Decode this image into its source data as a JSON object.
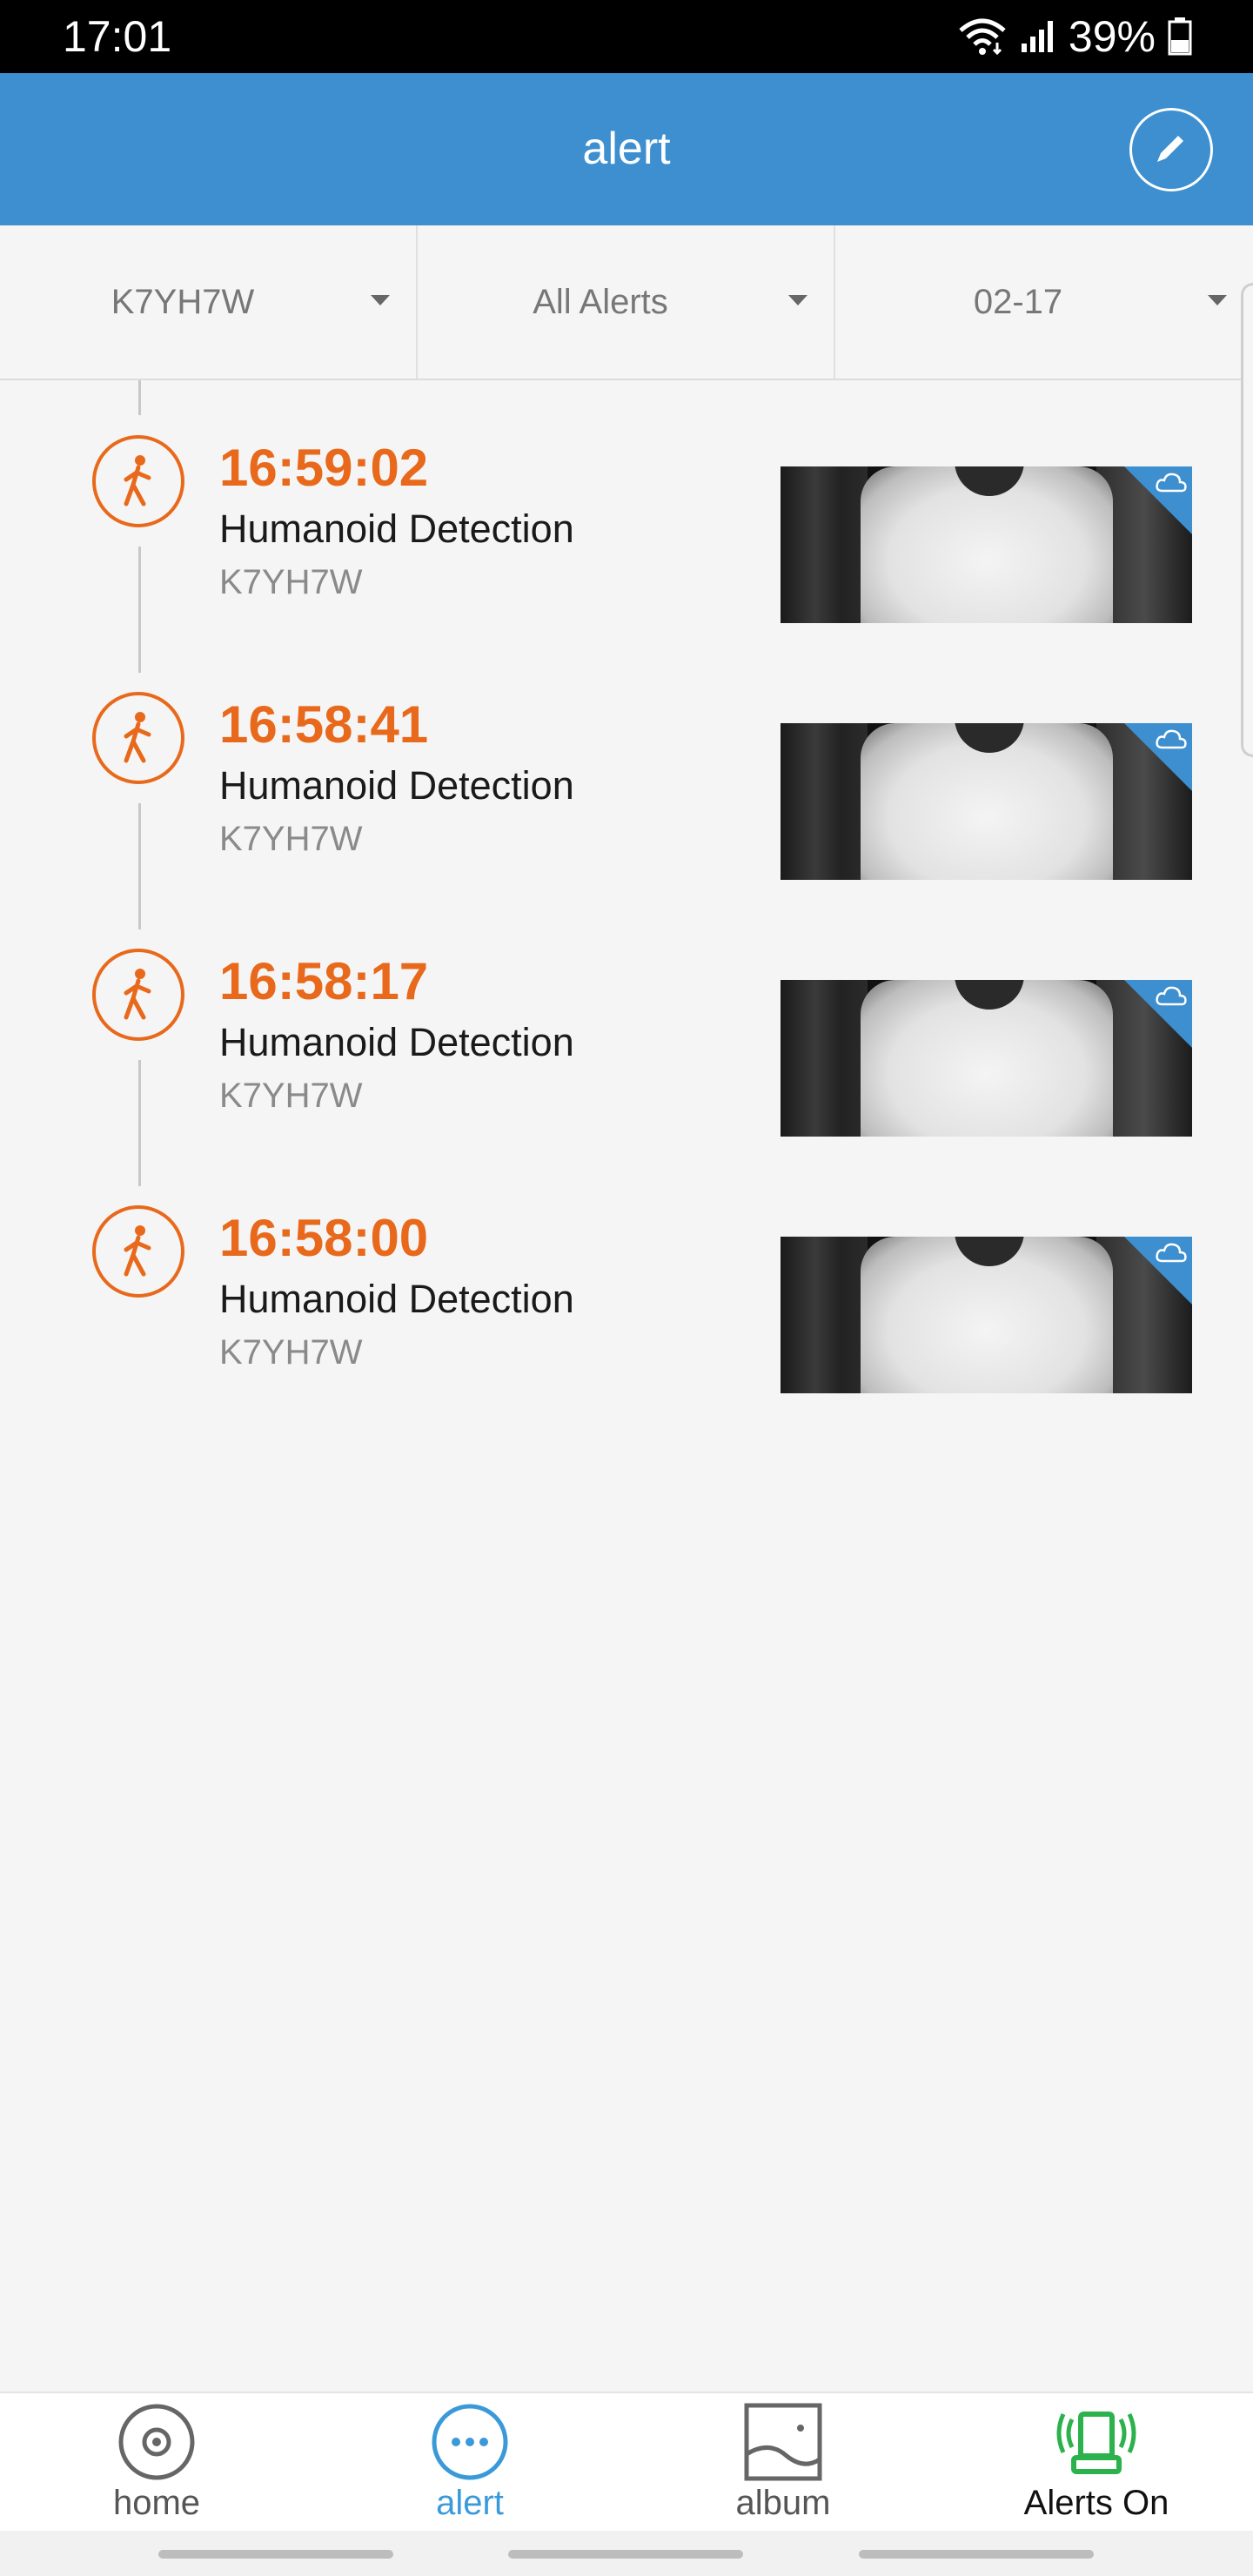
{
  "status_bar": {
    "time": "17:01",
    "battery": "39%"
  },
  "header": {
    "title": "alert",
    "edit_icon": "pencil-icon"
  },
  "filters": [
    {
      "label": "K7YH7W"
    },
    {
      "label": "All Alerts"
    },
    {
      "label": "02-17"
    }
  ],
  "alerts": [
    {
      "time": "16:59:02",
      "type": "Humanoid Detection",
      "device": "K7YH7W",
      "icon": "walking-person-icon",
      "cloud": "cloud-icon"
    },
    {
      "time": "16:58:41",
      "type": "Humanoid Detection",
      "device": "K7YH7W",
      "icon": "walking-person-icon",
      "cloud": "cloud-icon"
    },
    {
      "time": "16:58:17",
      "type": "Humanoid Detection",
      "device": "K7YH7W",
      "icon": "walking-person-icon",
      "cloud": "cloud-icon"
    },
    {
      "time": "16:58:00",
      "type": "Humanoid Detection",
      "device": "K7YH7W",
      "icon": "walking-person-icon",
      "cloud": "cloud-icon"
    }
  ],
  "bottom_nav": [
    {
      "label": "home",
      "icon": "home-camera-icon"
    },
    {
      "label": "alert",
      "icon": "chat-dots-icon",
      "active": true
    },
    {
      "label": "album",
      "icon": "album-icon"
    },
    {
      "label": "Alerts On",
      "icon": "alarm-bell-icon"
    }
  ],
  "colors": {
    "header": "#3d8fcf",
    "accent_orange": "#e8691b",
    "active_blue": "#3a9ad9",
    "alerts_on_green": "#2bb24c"
  }
}
